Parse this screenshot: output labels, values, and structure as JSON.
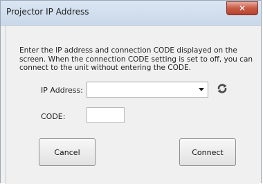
{
  "window": {
    "title": "Projector IP Address",
    "close_label": "✕"
  },
  "dialog": {
    "description": "Enter the IP address and connection CODE displayed on the screen. When the connection CODE setting is set to off, you can connect to the unit without entering the CODE.",
    "ip_address": {
      "label": "IP Address:",
      "value": ""
    },
    "code": {
      "label": "CODE:",
      "value": ""
    },
    "icons": {
      "refresh": "refresh-icon",
      "dropdown": "chevron-down-icon"
    }
  },
  "buttons": {
    "cancel_label": "Cancel",
    "connect_label": "Connect"
  }
}
